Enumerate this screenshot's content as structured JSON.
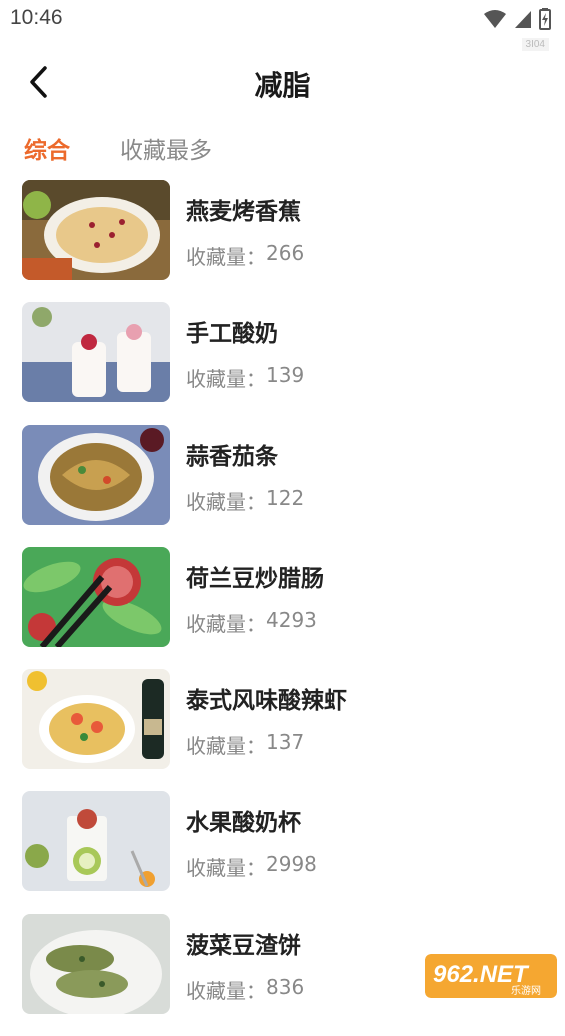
{
  "status": {
    "time": "10:46",
    "watermark_id": "3I04"
  },
  "header": {
    "title": "减脂",
    "back_icon": "chevron-left-icon"
  },
  "tabs": [
    {
      "label": "综合",
      "active": true
    },
    {
      "label": "收藏最多",
      "active": false
    }
  ],
  "colors": {
    "accent": "#ec6a2c",
    "text_primary": "#222222",
    "text_secondary": "#888888"
  },
  "count_label": "收藏量：",
  "recipes": [
    {
      "title": "燕麦烤香蕉",
      "count": "266"
    },
    {
      "title": "手工酸奶",
      "count": "139"
    },
    {
      "title": "蒜香茄条",
      "count": "122"
    },
    {
      "title": "荷兰豆炒腊肠",
      "count": "4293"
    },
    {
      "title": "泰式风味酸辣虾",
      "count": "137"
    },
    {
      "title": "水果酸奶杯",
      "count": "2998"
    },
    {
      "title": "菠菜豆渣饼",
      "count": "836"
    }
  ],
  "logo": {
    "text": "962.NET",
    "subtext": "乐游网"
  }
}
